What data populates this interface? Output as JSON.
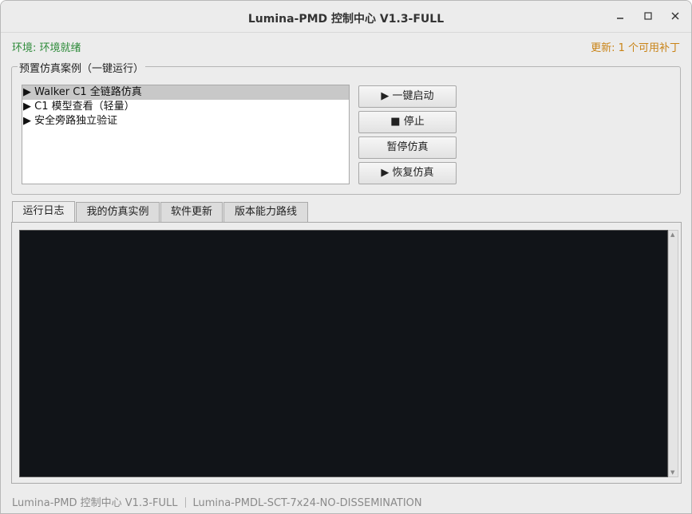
{
  "window": {
    "title": "Lumina-PMD 控制中心  V1.3-FULL",
    "controls": {
      "minimize": "minimize-icon",
      "maximize": "maximize-icon",
      "close": "close-icon"
    }
  },
  "status": {
    "env_text": "环境: 环境就绪",
    "update_text": "更新: 1 个可用补丁",
    "env_color": "#2e8b3a",
    "update_color": "#c98316"
  },
  "presets": {
    "group_label": "预置仿真案例（一键运行）",
    "items": [
      {
        "label": "▶ Walker C1 全链路仿真"
      },
      {
        "label": "▶ C1 模型查看（轻量）"
      },
      {
        "label": "▶ 安全旁路独立验证"
      }
    ],
    "buttons": {
      "start": "▶ 一键启动",
      "stop": "■ 停止",
      "pause": "暂停仿真",
      "resume": "▶ 恢复仿真"
    }
  },
  "tabs": [
    {
      "label": "运行日志"
    },
    {
      "label": "我的仿真实例"
    },
    {
      "label": "软件更新"
    },
    {
      "label": "版本能力路线"
    }
  ],
  "footer": {
    "left": "Lumina-PMD 控制中心 V1.3-FULL",
    "right": "Lumina-PMDL-SCT-7x24-NO-DISSEMINATION"
  }
}
